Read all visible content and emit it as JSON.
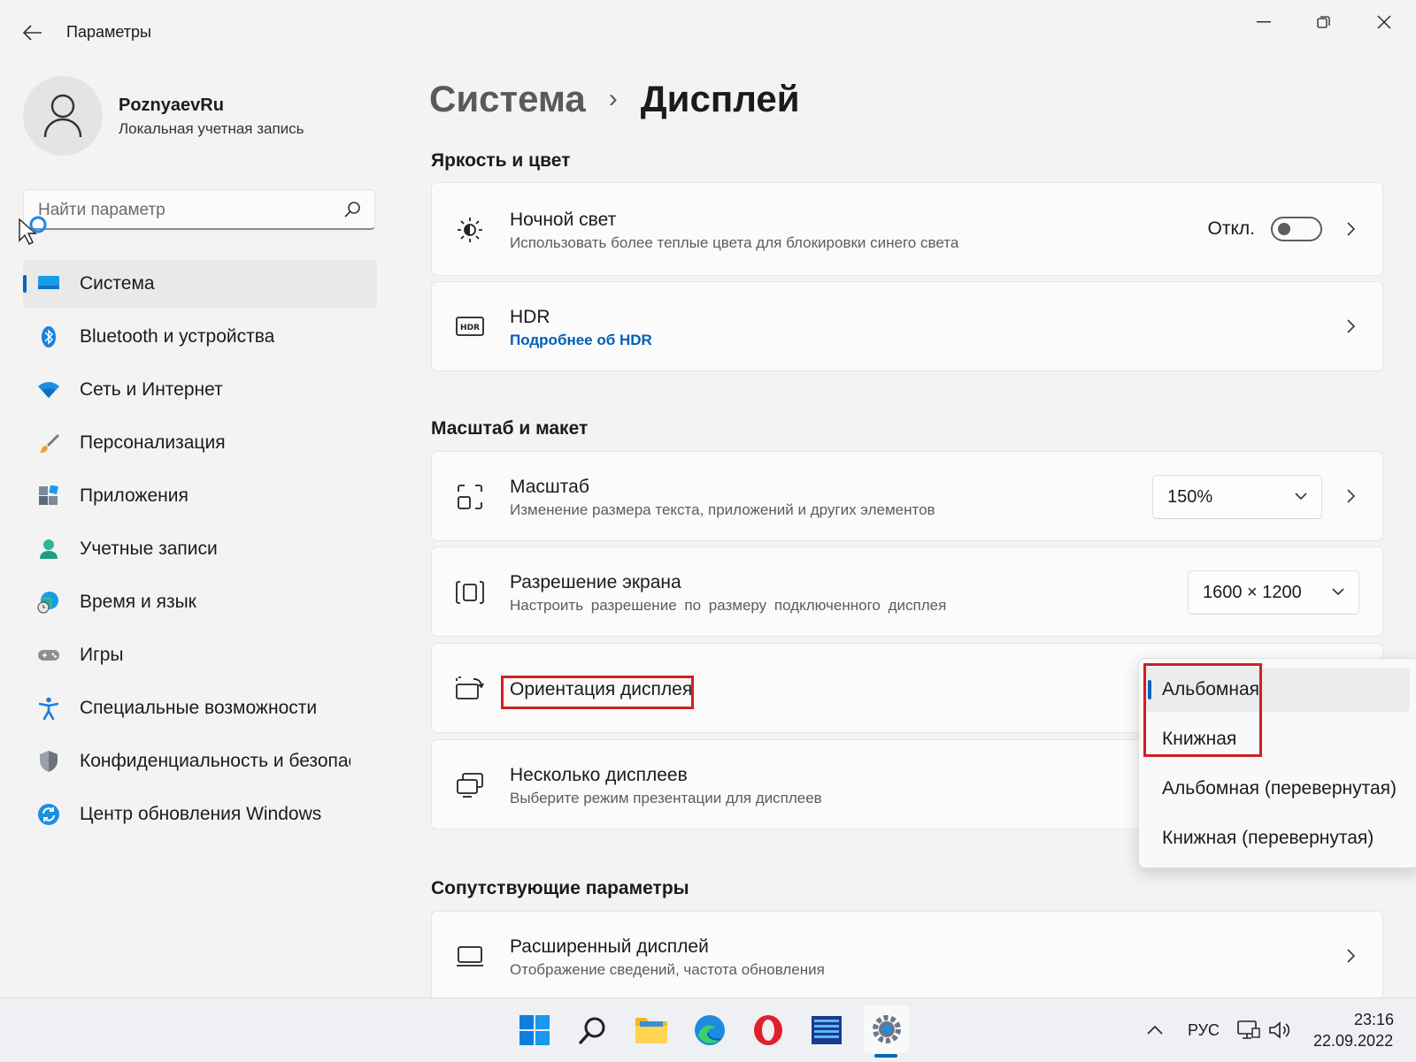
{
  "window": {
    "title": "Параметры"
  },
  "user": {
    "name": "PoznyaevRu",
    "account_type": "Локальная учетная запись"
  },
  "search": {
    "placeholder": "Найти параметр"
  },
  "sidebar": {
    "items": [
      {
        "label": "Система",
        "icon": "system-icon",
        "active": true
      },
      {
        "label": "Bluetooth и устройства",
        "icon": "bluetooth-icon"
      },
      {
        "label": "Сеть и Интернет",
        "icon": "wifi-icon"
      },
      {
        "label": "Персонализация",
        "icon": "brush-icon"
      },
      {
        "label": "Приложения",
        "icon": "apps-icon"
      },
      {
        "label": "Учетные записи",
        "icon": "accounts-icon"
      },
      {
        "label": "Время и язык",
        "icon": "globe-clock-icon"
      },
      {
        "label": "Игры",
        "icon": "gamepad-icon"
      },
      {
        "label": "Специальные возможности",
        "icon": "accessibility-icon"
      },
      {
        "label": "Конфиденциальность и безопас",
        "icon": "shield-icon"
      },
      {
        "label": "Центр обновления Windows",
        "icon": "update-icon"
      }
    ]
  },
  "breadcrumb": {
    "parent": "Система",
    "separator": "›",
    "current": "Дисплей"
  },
  "sections": {
    "brightness": "Яркость и цвет",
    "scale_layout": "Масштаб и макет",
    "related": "Сопутствующие параметры"
  },
  "night_light": {
    "title": "Ночной свет",
    "subtitle": "Использовать более теплые цвета для блокировки синего света",
    "state_label": "Откл.",
    "on": false
  },
  "hdr": {
    "title": "HDR",
    "link": "Подробнее об HDR"
  },
  "scale": {
    "title": "Масштаб",
    "subtitle": "Изменение размера текста, приложений и других элементов",
    "value": "150%"
  },
  "resolution": {
    "title": "Разрешение экрана",
    "subtitle": "Настроить разрешение по размеру подключенного дисплея",
    "value": "1600 × 1200"
  },
  "orientation": {
    "title": "Ориентация дисплея",
    "options": [
      "Альбомная",
      "Книжная",
      "Альбомная (перевернутая)",
      "Книжная (перевернутая)"
    ],
    "selected": "Альбомная"
  },
  "multi_display": {
    "title": "Несколько дисплеев",
    "subtitle": "Выберите режим презентации для дисплеев"
  },
  "extended_display": {
    "title": "Расширенный дисплей",
    "subtitle": "Отображение сведений, частота обновления"
  },
  "taskbar": {
    "language": "РУС",
    "time": "23:16",
    "date": "22.09.2022"
  },
  "colors": {
    "accent": "#0067c0",
    "link": "#005fb8",
    "highlight_box": "#d11f1f"
  }
}
